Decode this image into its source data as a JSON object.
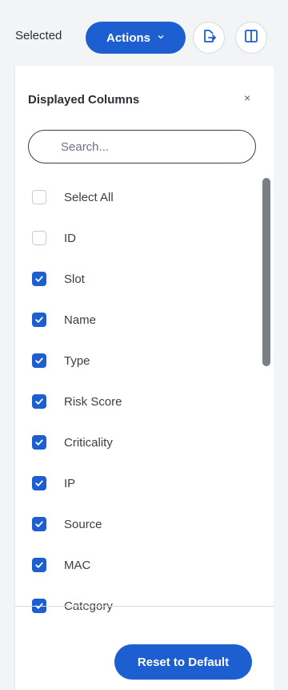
{
  "toolbar": {
    "selected_label": "Selected",
    "actions_label": "Actions",
    "actions_icon": "chevron-down-icon",
    "export_icon": "export-icon",
    "columns_icon": "columns-icon"
  },
  "panel": {
    "title": "Displayed Columns",
    "close_label": "×",
    "search": {
      "placeholder": "Search...",
      "value": ""
    },
    "select_all": {
      "label": "Select All",
      "checked": false
    },
    "columns": [
      {
        "label": "ID",
        "checked": false
      },
      {
        "label": "Slot",
        "checked": true
      },
      {
        "label": "Name",
        "checked": true
      },
      {
        "label": "Type",
        "checked": true
      },
      {
        "label": "Risk Score",
        "checked": true
      },
      {
        "label": "Criticality",
        "checked": true
      },
      {
        "label": "IP",
        "checked": true
      },
      {
        "label": "Source",
        "checked": true
      },
      {
        "label": "MAC",
        "checked": true
      },
      {
        "label": "Category",
        "checked": true
      }
    ],
    "reset_label": "Reset to Default"
  },
  "colors": {
    "accent": "#1d5fd1",
    "checkbox_off_border": "#c7ccd4",
    "scrollbar": "#7a7f87"
  }
}
